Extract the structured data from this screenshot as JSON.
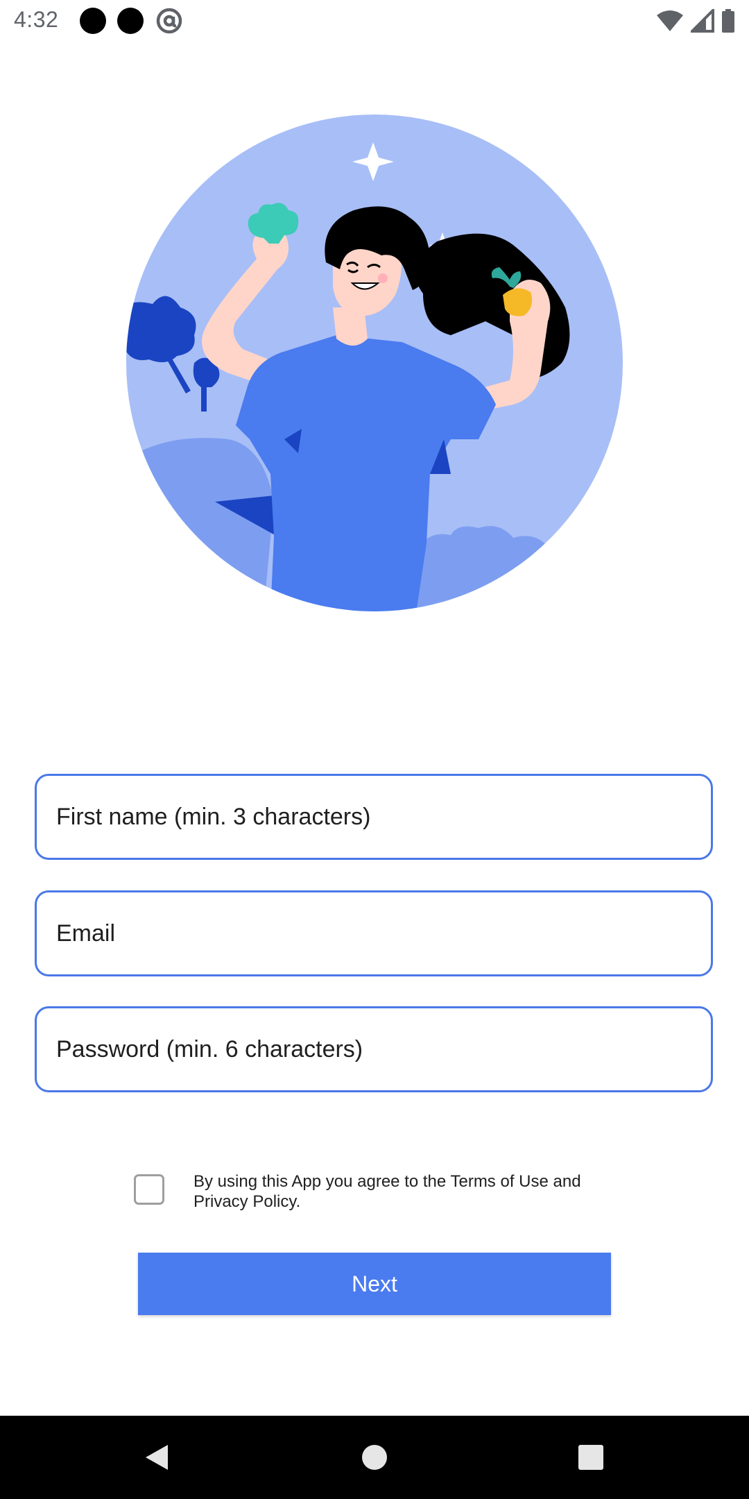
{
  "status_bar": {
    "time": "4:32",
    "icons": [
      "notification-dot-icon",
      "notification-dot-icon",
      "at-sign-icon",
      "wifi-icon",
      "cell-signal-icon",
      "battery-icon"
    ]
  },
  "illustration": {
    "description_icon": "woman-celebrating-with-vegetables-illustration",
    "colors": {
      "circle": "#a8bef7",
      "shirt": "#4a7bef",
      "dark_blue": "#1a44c2",
      "hair": "#000000",
      "skin": "#ffd5c9",
      "broccoli": "#3ccbb6",
      "carrot": "#f5b827"
    }
  },
  "form": {
    "first_name": {
      "placeholder": "First name (min. 3 characters)",
      "value": ""
    },
    "email": {
      "placeholder": "Email",
      "value": ""
    },
    "password": {
      "placeholder": "Password (min. 6 characters)",
      "value": ""
    }
  },
  "consent": {
    "checked": false,
    "text": "By using this App you agree to the Terms of Use and Privacy Policy."
  },
  "next_button": {
    "label": "Next",
    "color": "#4a7bef"
  },
  "nav_bar": {
    "icons": [
      "back-icon",
      "home-icon",
      "recents-icon"
    ]
  }
}
